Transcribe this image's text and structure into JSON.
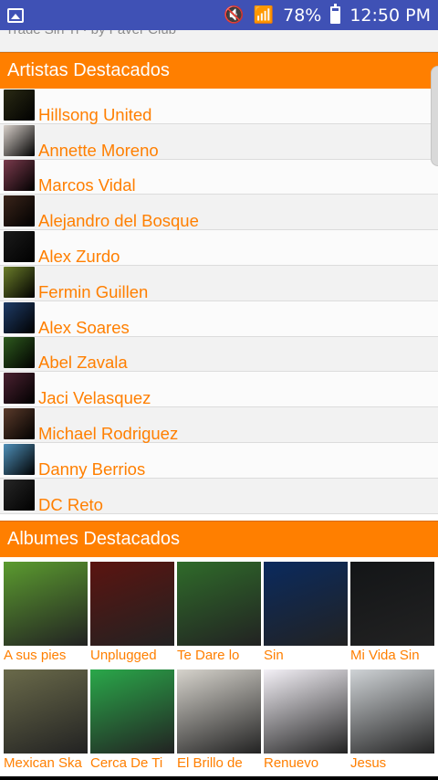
{
  "status_bar": {
    "battery": "78%",
    "time": "12:50 PM",
    "icons": [
      "image-icon",
      "mute-icon",
      "wifi-icon",
      "signal-icon",
      "battery-icon"
    ]
  },
  "search": {
    "partial_text": "Trade Sin Ti · by Faver Club"
  },
  "artists_section": {
    "title": "Artistas Destacados",
    "items": [
      {
        "name": "Hillsong United",
        "thumb": "#2a2a14"
      },
      {
        "name": "Annette Moreno",
        "thumb": "#d7cfc9"
      },
      {
        "name": "Marcos Vidal",
        "thumb": "#7a3a4c"
      },
      {
        "name": "Alejandro del Bosque",
        "thumb": "#3a241a"
      },
      {
        "name": "Alex Zurdo",
        "thumb": "#1b1b1b"
      },
      {
        "name": "Fermin Guillen",
        "thumb": "#6b7d2a"
      },
      {
        "name": "Alex Soares",
        "thumb": "#1f3c67"
      },
      {
        "name": "Abel Zavala",
        "thumb": "#2e5a1e"
      },
      {
        "name": "Jaci Velasquez",
        "thumb": "#4a2130"
      },
      {
        "name": "Michael Rodriguez",
        "thumb": "#5a3a2a"
      },
      {
        "name": "Danny Berrios",
        "thumb": "#4e8fb8"
      },
      {
        "name": "DC Reto",
        "thumb": "#262626"
      }
    ]
  },
  "albums_section": {
    "title": "Albumes Destacados",
    "items": [
      {
        "title": "A sus pies",
        "cover": "#5b9b2f"
      },
      {
        "title": "Unplugged",
        "cover": "#5b1410"
      },
      {
        "title": "Te Dare lo",
        "cover": "#2f6b2a"
      },
      {
        "title": "Sin",
        "cover": "#0a2a5e"
      },
      {
        "title": "Mi Vida Sin",
        "cover": "#131517"
      },
      {
        "title": "Mexican Ska",
        "cover": "#6a6a4a"
      },
      {
        "title": "Cerca De Ti",
        "cover": "#2aa84a"
      },
      {
        "title": "El Brillo de",
        "cover": "#d6d3cc"
      },
      {
        "title": "Renuevo",
        "cover": "#f4f1f7"
      },
      {
        "title": "Jesus",
        "cover": "#cfd3d6"
      }
    ]
  },
  "colors": {
    "accent": "#ff7f00",
    "status_bar": "#3f51b5"
  }
}
